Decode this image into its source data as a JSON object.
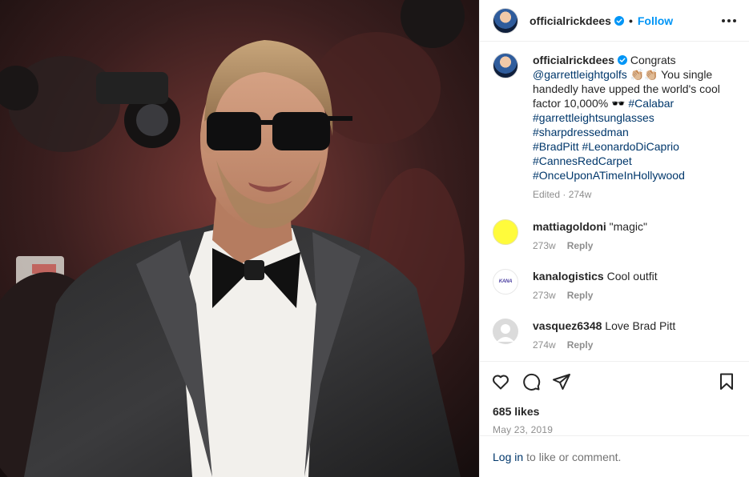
{
  "header": {
    "username": "officialrickdees",
    "separator": "•",
    "follow_label": "Follow",
    "more_icon": "more-horizontal-icon"
  },
  "caption": {
    "username": "officialrickdees",
    "text_1": "Congrats",
    "mention": "@garrettleightgolfs",
    "emoji_1": "👏🏼👏🏼",
    "text_2": "You single handedly have upped the world's cool factor 10,000%",
    "emoji_2": "🕶️",
    "hashtags": [
      "#Calabar",
      "#garrettleightsunglasses",
      "#sharpdressedman",
      "#BradPitt",
      "#LeonardoDiCaprio",
      "#CannesRedCarpet",
      "#OnceUponATimeInHollywood"
    ],
    "meta": "Edited · 274w"
  },
  "comments": [
    {
      "username": "mattiagoldoni",
      "text": "\"magic\"",
      "age": "273w",
      "reply": "Reply"
    },
    {
      "username": "kanalogistics",
      "text": "Cool outfit",
      "age": "273w",
      "reply": "Reply",
      "avatar_text": "KANA"
    },
    {
      "username": "vasquez6348",
      "text": "Love Brad Pitt",
      "age": "274w",
      "reply": "Reply"
    }
  ],
  "actions": {
    "like_icon": "heart-icon",
    "comment_icon": "comment-icon",
    "share_icon": "share-icon",
    "save_icon": "bookmark-icon"
  },
  "likes": "685 likes",
  "date": "May 23, 2019",
  "login": {
    "link": "Log in",
    "text": "to like or comment."
  },
  "colors": {
    "link": "#00376b",
    "follow": "#0095f6",
    "muted": "#8e8e8e",
    "verified": "#0095f6"
  }
}
